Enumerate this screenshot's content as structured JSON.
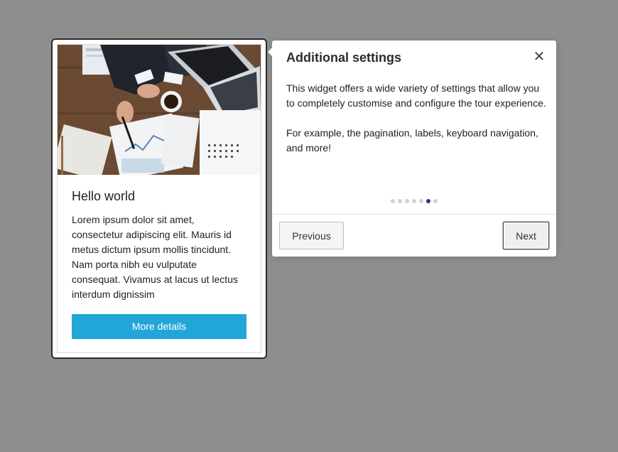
{
  "card": {
    "image_alt": "Business desk with laptop, coffee and charts",
    "title": "Hello world",
    "text": "Lorem ipsum dolor sit amet, consectetur adipiscing elit. Mauris id metus dictum ipsum mollis tincidunt. Nam porta nibh eu vulputate consequat. Vivamus at lacus ut lectus interdum dignissim",
    "button_label": "More details"
  },
  "popover": {
    "title": "Additional settings",
    "close_glyph": "✕",
    "paragraphs": [
      "This widget offers a wide variety of settings that allow you to completely customise and configure the tour experience.",
      "For example, the pagination, labels, keyboard navigation, and more!"
    ],
    "progress": {
      "total": 7,
      "current": 6
    },
    "prev_label": "Previous",
    "next_label": "Next"
  },
  "colors": {
    "overlay": "#8e8e8e",
    "button_primary": "#22a6d8",
    "active_dot": "#1f3a8a"
  }
}
